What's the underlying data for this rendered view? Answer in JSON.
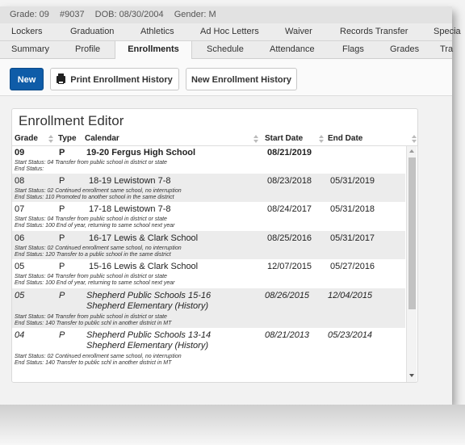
{
  "student_info": {
    "grade": "Grade: 09",
    "id": "#9037",
    "dob": "DOB: 08/30/2004",
    "gender": "Gender: M"
  },
  "tabs_row1": [
    "Lockers",
    "Graduation",
    "Athletics",
    "Ad Hoc Letters",
    "Waiver",
    "Records Transfer",
    "Specia"
  ],
  "tabs_row2": [
    "Summary",
    "Profile",
    "Enrollments",
    "Schedule",
    "Attendance",
    "Flags",
    "Grades",
    "Tra"
  ],
  "active_tab": "Enrollments",
  "toolbar": {
    "new_label": "New",
    "print_label": "Print Enrollment History",
    "new_history_label": "New Enrollment History"
  },
  "editor": {
    "title": "Enrollment Editor",
    "columns": {
      "grade": "Grade",
      "type": "Type",
      "calendar": "Calendar",
      "start": "Start Date",
      "end": "End Date"
    },
    "rows": [
      {
        "grade": "09",
        "type": "P",
        "calendar": "19-20 Fergus High School",
        "start": "08/21/2019",
        "end": "",
        "start_status": "Start Status: 04 Transfer from public school in district or state",
        "end_status": "End Status:"
      },
      {
        "grade": "08",
        "type": "P",
        "calendar": "18-19 Lewistown 7-8",
        "start": "08/23/2018",
        "end": "05/31/2019",
        "start_status": "Start Status: 02 Continued enrollment same school, no interruption",
        "end_status": "End Status: 110 Promoted to another school in the same district"
      },
      {
        "grade": "07",
        "type": "P",
        "calendar": "17-18 Lewistown 7-8",
        "start": "08/24/2017",
        "end": "05/31/2018",
        "start_status": "Start Status: 04 Transfer from public school in district or state",
        "end_status": "End Status: 100 End of year, returning to same school next year"
      },
      {
        "grade": "06",
        "type": "P",
        "calendar": "16-17 Lewis & Clark School",
        "start": "08/25/2016",
        "end": "05/31/2017",
        "start_status": "Start Status: 02 Continued enrollment same school, no interruption",
        "end_status": "End Status: 120 Transfer to a public school in the same district"
      },
      {
        "grade": "05",
        "type": "P",
        "calendar": "15-16 Lewis & Clark School",
        "start": "12/07/2015",
        "end": "05/27/2016",
        "start_status": "Start Status: 04 Transfer from public school in district or state",
        "end_status": "End Status: 100 End of year, returning to same school next year"
      },
      {
        "grade": "05",
        "type": "P",
        "calendar": "Shepherd Public Schools 15-16 Shepherd Elementary (History)",
        "start": "08/26/2015",
        "end": "12/04/2015",
        "start_status": "Start Status: 04 Transfer from public school in district or state",
        "end_status": "End Status: 140 Transfer to public schl in another district in MT"
      },
      {
        "grade": "04",
        "type": "P",
        "calendar": "Shepherd Public Schools 13-14 Shepherd Elementary (History)",
        "start": "08/21/2013",
        "end": "05/23/2014",
        "start_status": "Start Status: 02 Continued enrollment same school, no interruption",
        "end_status": "End Status: 140 Transfer to public schl in another district in MT"
      }
    ]
  }
}
